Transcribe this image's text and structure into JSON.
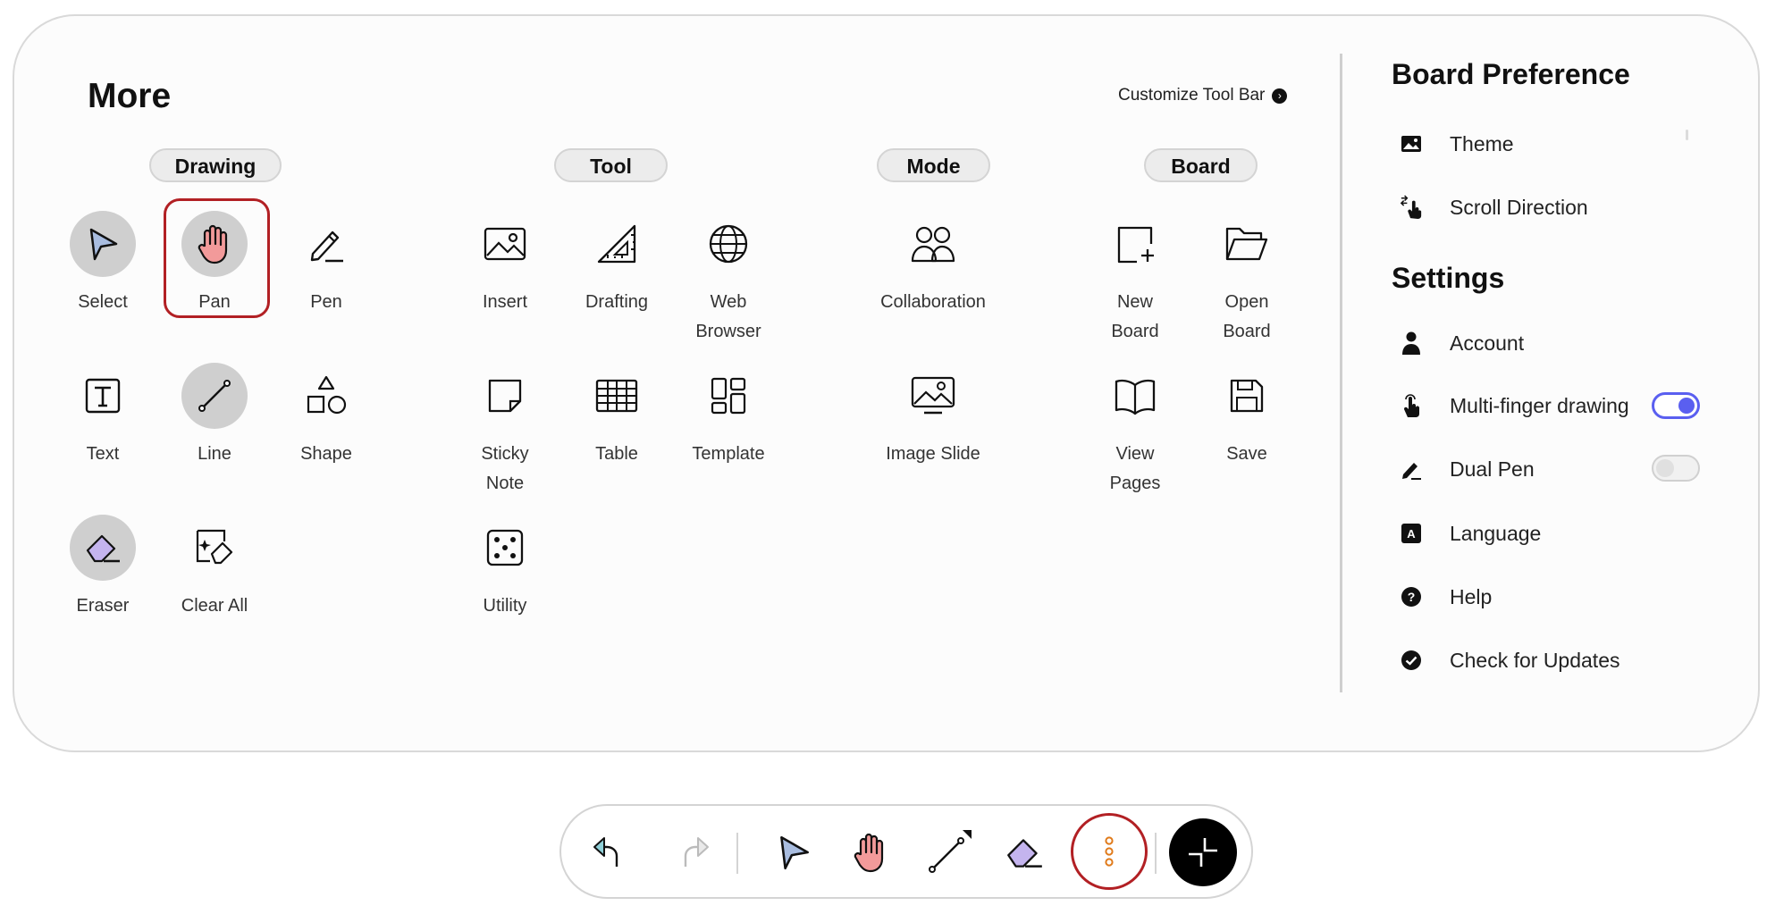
{
  "panel": {
    "title": "More",
    "customize_label": "Customize Tool Bar"
  },
  "sections": {
    "drawing": "Drawing",
    "tool": "Tool",
    "mode": "Mode",
    "board": "Board"
  },
  "tools": {
    "select": "Select",
    "pan": "Pan",
    "pen": "Pen",
    "text": "Text",
    "line": "Line",
    "shape": "Shape",
    "eraser": "Eraser",
    "clear_all": "Clear All",
    "insert": "Insert",
    "drafting": "Drafting",
    "web_browser": "Web\nBrowser",
    "sticky_note": "Sticky\nNote",
    "table": "Table",
    "template": "Template",
    "utility": "Utility",
    "collaboration": "Collaboration",
    "image_slide": "Image Slide",
    "new_board": "New\nBoard",
    "open_board": "Open\nBoard",
    "view_pages": "View\nPages",
    "save": "Save"
  },
  "board_preference": {
    "title": "Board Preference",
    "theme": "Theme",
    "scroll_direction": "Scroll Direction"
  },
  "settings": {
    "title": "Settings",
    "account": "Account",
    "multi_finger": "Multi-finger drawing",
    "multi_finger_on": true,
    "dual_pen": "Dual Pen",
    "dual_pen_on": false,
    "language": "Language",
    "help": "Help",
    "check_updates": "Check for Updates"
  },
  "colors": {
    "accent": "#5a5ff0",
    "highlight": "#b22024",
    "pan_hand": "#f29a9a",
    "select_arrow": "#a9bde0",
    "eraser": "#c4b4ee"
  }
}
